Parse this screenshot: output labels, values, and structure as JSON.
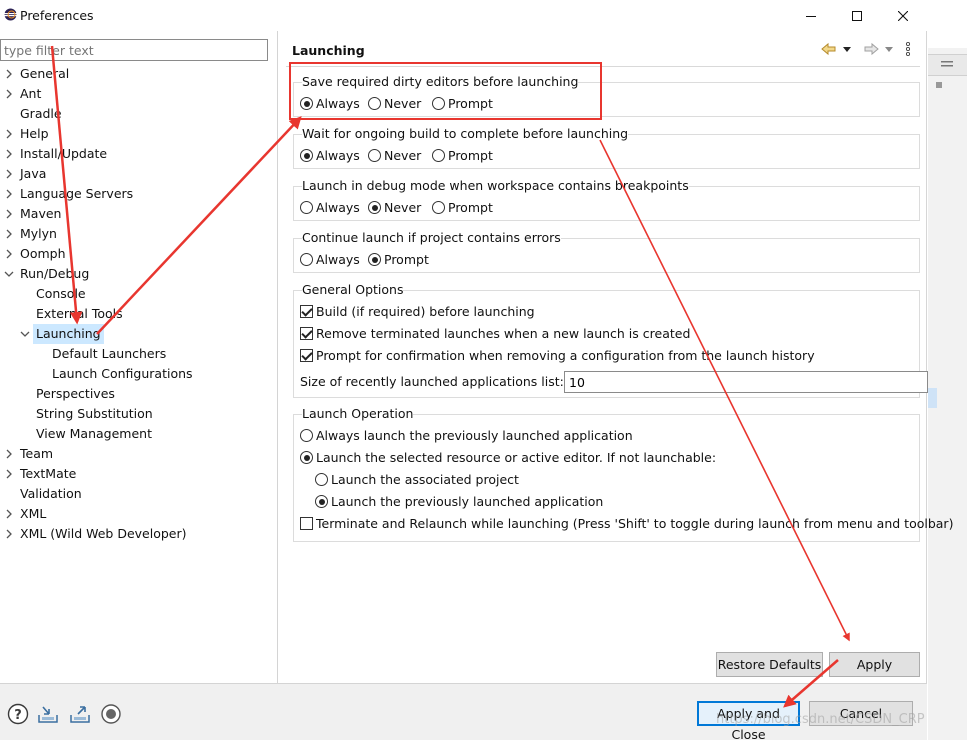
{
  "window": {
    "title": "Preferences"
  },
  "filter": {
    "placeholder": "type filter text"
  },
  "tree": {
    "items": [
      {
        "label": "General",
        "expander": "collapsed"
      },
      {
        "label": "Ant",
        "expander": "collapsed"
      },
      {
        "label": "Gradle",
        "expander": "none"
      },
      {
        "label": "Help",
        "expander": "collapsed"
      },
      {
        "label": "Install/Update",
        "expander": "collapsed"
      },
      {
        "label": "Java",
        "expander": "collapsed"
      },
      {
        "label": "Language Servers",
        "expander": "collapsed"
      },
      {
        "label": "Maven",
        "expander": "collapsed"
      },
      {
        "label": "Mylyn",
        "expander": "collapsed"
      },
      {
        "label": "Oomph",
        "expander": "collapsed"
      },
      {
        "label": "Run/Debug",
        "expander": "expanded"
      },
      {
        "label": "Console",
        "expander": "none"
      },
      {
        "label": "External Tools",
        "expander": "none"
      },
      {
        "label": "Launching",
        "expander": "expanded",
        "selected": true
      },
      {
        "label": "Default Launchers",
        "expander": "none"
      },
      {
        "label": "Launch Configurations",
        "expander": "none"
      },
      {
        "label": "Perspectives",
        "expander": "none"
      },
      {
        "label": "String Substitution",
        "expander": "none"
      },
      {
        "label": "View Management",
        "expander": "none"
      },
      {
        "label": "Team",
        "expander": "collapsed"
      },
      {
        "label": "TextMate",
        "expander": "collapsed"
      },
      {
        "label": "Validation",
        "expander": "none"
      },
      {
        "label": "XML",
        "expander": "collapsed"
      },
      {
        "label": "XML (Wild Web Developer)",
        "expander": "collapsed"
      }
    ]
  },
  "page": {
    "title": "Launching",
    "groups": {
      "save_dirty": {
        "label": "Save required dirty editors before launching",
        "options": [
          "Always",
          "Never",
          "Prompt"
        ],
        "selected": "Always"
      },
      "wait_build": {
        "label": "Wait for ongoing build to complete before launching",
        "options": [
          "Always",
          "Never",
          "Prompt"
        ],
        "selected": "Always"
      },
      "debug_mode": {
        "label": "Launch in debug mode when workspace contains breakpoints",
        "options": [
          "Always",
          "Never",
          "Prompt"
        ],
        "selected": "Never"
      },
      "continue_errors": {
        "label": "Continue launch if project contains errors",
        "options": [
          "Always",
          "Prompt"
        ],
        "selected": "Prompt"
      },
      "general": {
        "label": "General Options",
        "checks": [
          {
            "label": "Build (if required) before launching",
            "checked": true
          },
          {
            "label": "Remove terminated launches when a new launch is created",
            "checked": true
          },
          {
            "label": "Prompt for confirmation when removing a configuration from the launch history",
            "checked": true
          }
        ],
        "size_label": "Size of recently launched applications list:",
        "size_value": "10"
      },
      "operation": {
        "label": "Launch Operation",
        "always_previous": "Always launch the previously launched application",
        "launch_selected": "Launch the selected resource or active editor. If not launchable:",
        "associated": "Launch the associated project",
        "previous": "Launch the previously launched application",
        "terminate": "Terminate and Relaunch while launching (Press 'Shift' to toggle during launch from menu and toolbar)"
      }
    },
    "restore_defaults": "Restore Defaults",
    "apply": "Apply"
  },
  "footer": {
    "apply_close": "Apply and Close",
    "cancel": "Cancel"
  },
  "watermark": "https://blog.csdn.net/CSDN_CRP",
  "colors": {
    "annotation": "#e8362f",
    "selection": "#cce8ff",
    "focus": "#0078d7"
  }
}
